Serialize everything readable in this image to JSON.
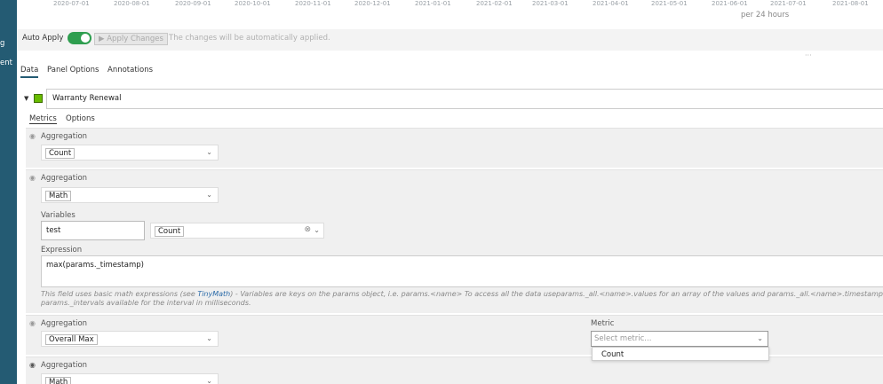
{
  "sidebar": {
    "labels": [
      "g",
      "ent"
    ]
  },
  "chart_axis": {
    "ticks": [
      "2020-07-01",
      "2020-08-01",
      "2020-09-01",
      "2020-10-01",
      "2020-11-01",
      "2020-12-01",
      "2021-01-01",
      "2021-02-01",
      "2021-03-01",
      "2021-04-01",
      "2021-05-01",
      "2021-06-01",
      "2021-07-01",
      "2021-08-01"
    ],
    "interval_label": "per 24 hours"
  },
  "apply": {
    "label": "Auto Apply",
    "toggle_on": true,
    "button_label": "▶ Apply Changes",
    "note": "The changes will be automatically applied."
  },
  "tabs": {
    "data": "Data",
    "panel_options": "Panel Options",
    "annotations": "Annotations"
  },
  "series": {
    "name": "Warranty Renewal",
    "color": "#68bc00"
  },
  "subtabs": {
    "metrics": "Metrics",
    "options": "Options"
  },
  "metrics": [
    {
      "agg_label": "Aggregation",
      "value": "Count"
    },
    {
      "agg_label": "Aggregation",
      "value": "Math",
      "variables_label": "Variables",
      "variable_name": "test",
      "variable_metric": "Count",
      "expression_label": "Expression",
      "expression": "max(params._timestamp)",
      "help_prefix": "This field uses basic math expressions (see ",
      "help_link": "TinyMath",
      "help_suffix": ") - Variables are keys on the params object, i.e. params.<name> To access all the data useparams._all.<name>.values for an array of the values and params._all.<name>.timestamps for the timestamps of each value.",
      "help_line2": "params._intervals available for the interval in milliseconds."
    },
    {
      "agg_label": "Aggregation",
      "value": "Overall Max",
      "metric_label": "Metric",
      "metric_placeholder": "Select metric...",
      "metric_option": "Count"
    },
    {
      "agg_label": "Aggregation",
      "value": "Math"
    }
  ]
}
